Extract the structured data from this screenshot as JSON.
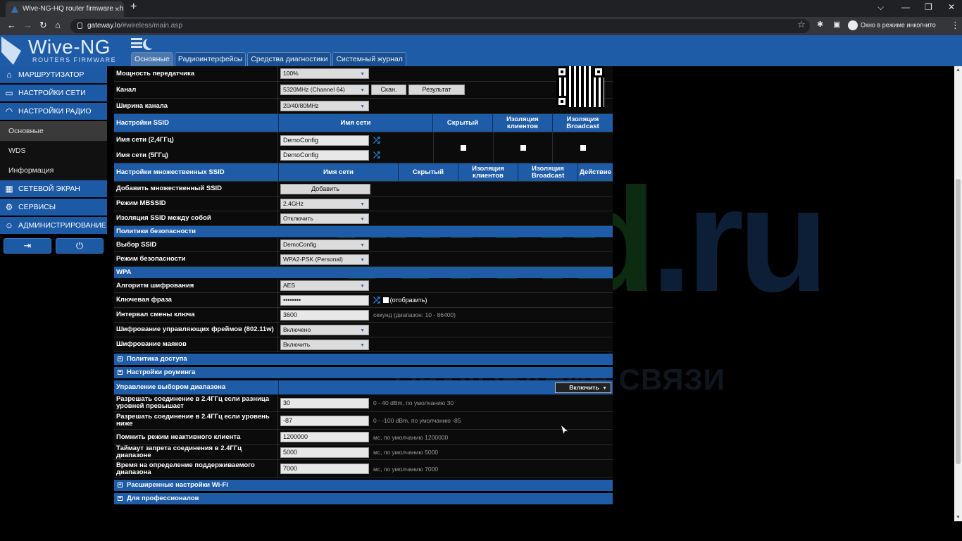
{
  "browser": {
    "tab_title": "Wive-NG-HQ router firmware - h",
    "tab_close": "×",
    "new_tab": "+",
    "url_host": "gateway.lo",
    "url_path": "/#wireless/main.asp",
    "incognito_label": "Окно в режиме инкогнито",
    "win_min": "—",
    "win_max": "❐",
    "win_close": "✕",
    "win_down": "⌵"
  },
  "header": {
    "logo": "Wive-NG",
    "logo_sub": "ROUTERS FIRMWARE",
    "tabs": [
      "Основные",
      "Радиоинтерфейсы",
      "Средства диагностики",
      "Системный журнал"
    ]
  },
  "sidebar": {
    "items": [
      {
        "label": "Маршрутизатор",
        "icon": "router-icon"
      },
      {
        "label": "Настройки сети",
        "icon": "network-icon"
      },
      {
        "label": "Настройки радио",
        "icon": "wifi-icon"
      }
    ],
    "subitems": [
      "Основные",
      "WDS",
      "Информация"
    ],
    "items2": [
      {
        "label": "Сетевой экран",
        "icon": "firewall-icon"
      },
      {
        "label": "Сервисы",
        "icon": "gear-icon"
      },
      {
        "label": "Администрирование",
        "icon": "admin-icon"
      }
    ]
  },
  "radio": {
    "tx_power_label": "Мощность передатчика",
    "tx_power_value": "100%",
    "channel_label": "Канал",
    "channel_value": "5320MHz (Channel 64)",
    "scan_btn": "Скан.",
    "result_btn": "Результат",
    "width_label": "Ширина канала",
    "width_value": "20/40/80MHz"
  },
  "ssid": {
    "header": [
      "Настройки SSID",
      "Имя сети",
      "Скрытый",
      "Изоляция клиентов",
      "Изоляция Broadcast"
    ],
    "r1_label": "Имя сети (2,4ГГц)",
    "r1_value": "DemoConfig",
    "r2_label": "Имя сети (5ГГц)",
    "r2_value": "DemoConfig"
  },
  "mssid": {
    "header": [
      "Настройки множественных SSID",
      "Имя сети",
      "Скрытый",
      "Изоляция клиентов",
      "Изоляция Broadcast",
      "Действие"
    ],
    "add_label": "Добавить множественный SSID",
    "add_btn": "Добавить",
    "mode_label": "Режим MBSSID",
    "mode_value": "2.4GHz",
    "iso_label": "Изоляция SSID между собой",
    "iso_value": "Отключить"
  },
  "security": {
    "section": "Политики безопасности",
    "ssid_label": "Выбор SSID",
    "ssid_value": "DemoConfig",
    "mode_label": "Режим безопасности",
    "mode_value": "WPA2-PSK (Personal)"
  },
  "wpa": {
    "section": "WPA",
    "alg_label": "Алгоритм шифрования",
    "alg_value": "AES",
    "key_label": "Ключевая фраза",
    "key_value": "••••••••",
    "key_show": "(отобразить)",
    "interval_label": "Интервал смены ключа",
    "interval_value": "3600",
    "interval_hint": "секунд (диапазон: 10 - 86400)",
    "mgmt_label": "Шифрование управляющих фреймов (802.11w)",
    "mgmt_value": "Включено",
    "beacon_label": "Шифрование маяков",
    "beacon_value": "Включить"
  },
  "collapsed": {
    "access": "Политика доступа",
    "roaming": "Настройки роуминга",
    "advanced": "Расширенные настройки Wi-Fi",
    "pro": "Для профессионалов"
  },
  "band": {
    "section": "Управление выбором диапазона",
    "section_value": "Включить",
    "r1_label": "Разрешать соединение в 2.4ГГц если разница уровней превышает",
    "r1_value": "30",
    "r1_hint": "0 - 40 dBm, по умолчанию 30",
    "r2_label": "Разрешать соединение в 2.4ГГц если уровень ниже",
    "r2_value": "-87",
    "r2_hint": "0 - -100 dBm, по умолчанию -85",
    "r3_label": "Помнить режим неактивного клиента",
    "r3_value": "1200000",
    "r3_hint": "мс, по умолчанию 1200000",
    "r4_label": "Таймаут запрета соединения в 2.4ГГц диапазоне",
    "r4_value": "5000",
    "r4_hint": "мс, по умолчанию 5000",
    "r5_label": "Время на определение поддерживаемого диапазона",
    "r5_value": "7000",
    "r5_hint": "мс, по умолчанию 7000"
  },
  "watermark": {
    "main": "wmd",
    "tld": ".ru",
    "sub": "ОРУДОВАНИЯ СВЯЗИ"
  }
}
